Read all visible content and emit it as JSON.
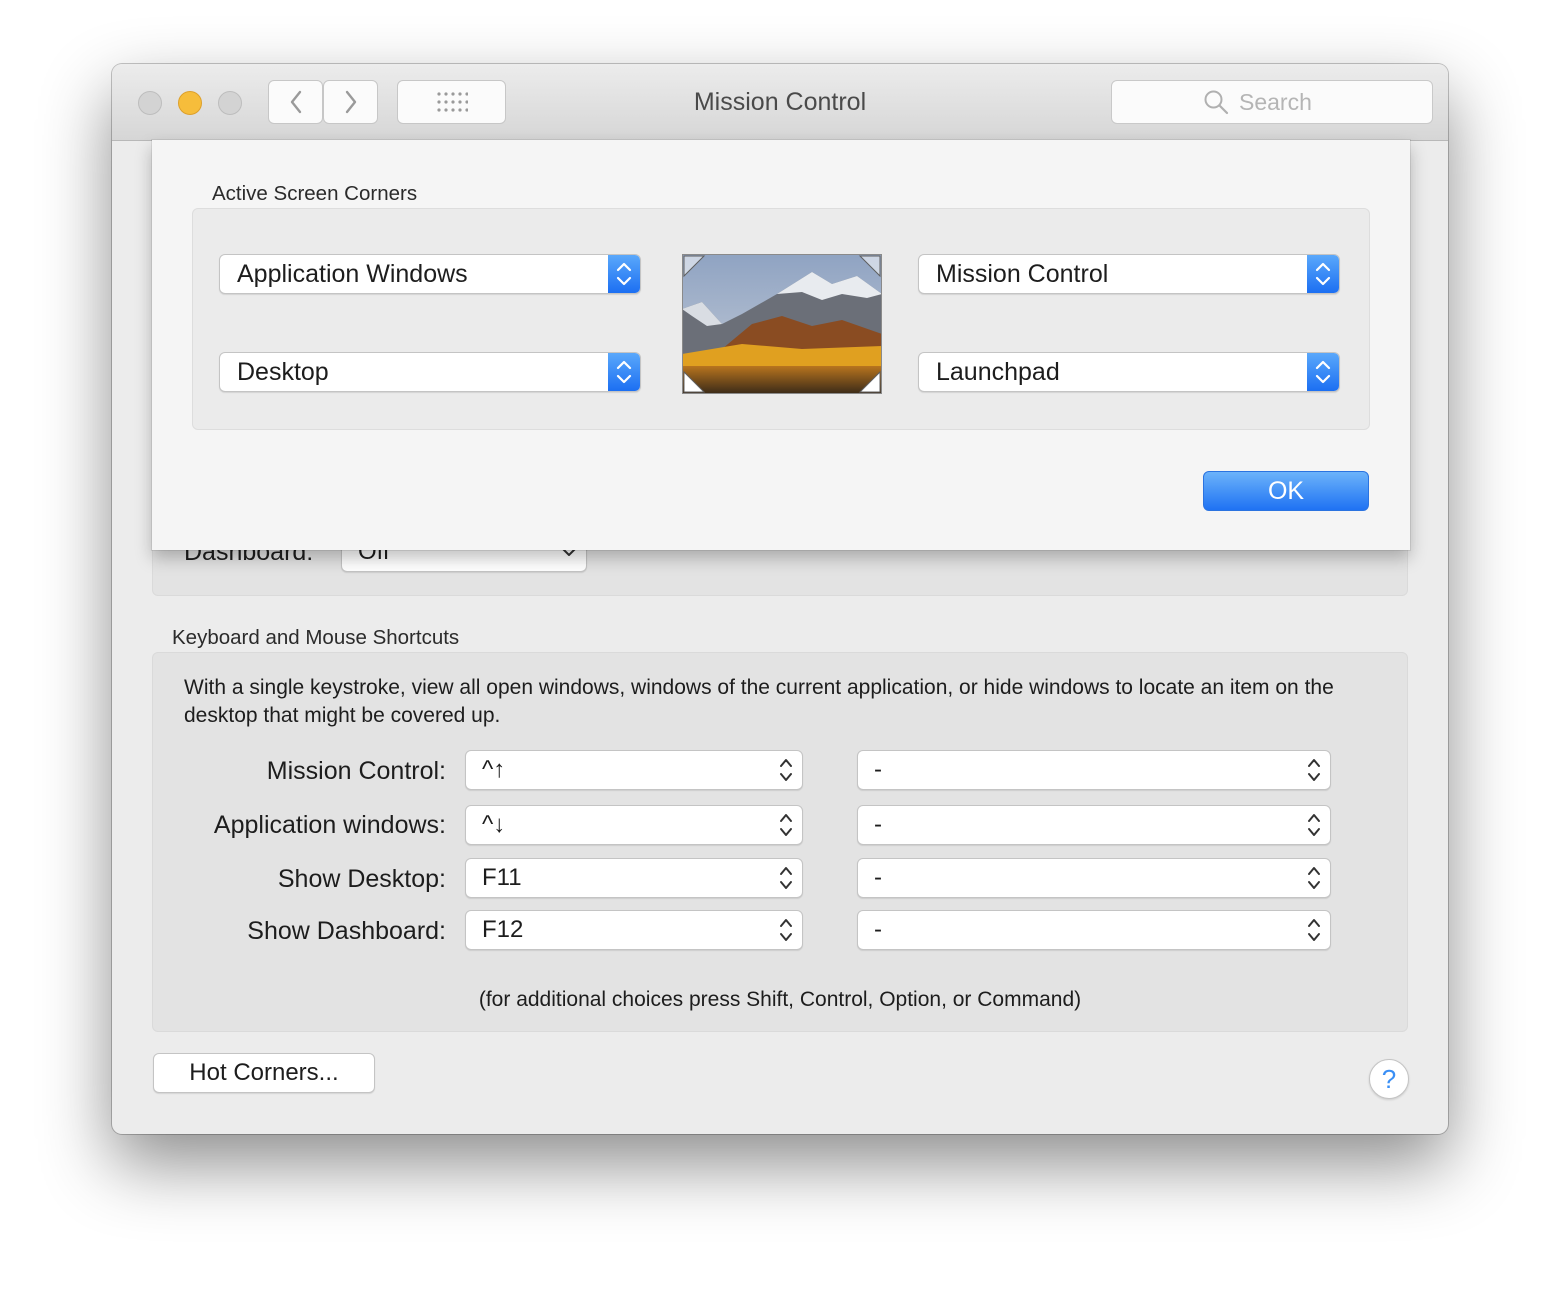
{
  "window": {
    "title": "Mission Control",
    "search_placeholder": "Search"
  },
  "behind": {
    "dashboard_label": "Dashboard:",
    "dashboard_value": "Off"
  },
  "shortcuts": {
    "heading": "Keyboard and Mouse Shortcuts",
    "description": "With a single keystroke, view all open windows, windows of the current application, or hide windows to locate an item on the desktop that might be covered up.",
    "rows": [
      {
        "label": "Mission Control:",
        "key": "^↑",
        "mouse": "-"
      },
      {
        "label": "Application windows:",
        "key": "^↓",
        "mouse": "-"
      },
      {
        "label": "Show Desktop:",
        "key": "F11",
        "mouse": "-"
      },
      {
        "label": "Show Dashboard:",
        "key": "F12",
        "mouse": "-"
      }
    ],
    "hint": "(for additional choices press Shift, Control, Option, or Command)"
  },
  "buttons": {
    "hot_corners": "Hot Corners...",
    "help": "?"
  },
  "sheet": {
    "heading": "Active Screen Corners",
    "top_left": "Application Windows",
    "bottom_left": "Desktop",
    "top_right": "Mission Control",
    "bottom_right": "Launchpad",
    "ok": "OK"
  },
  "colors": {
    "accent": "#1f72f3",
    "minimize": "#f6bd3b",
    "help_text": "#3a8ff5"
  }
}
